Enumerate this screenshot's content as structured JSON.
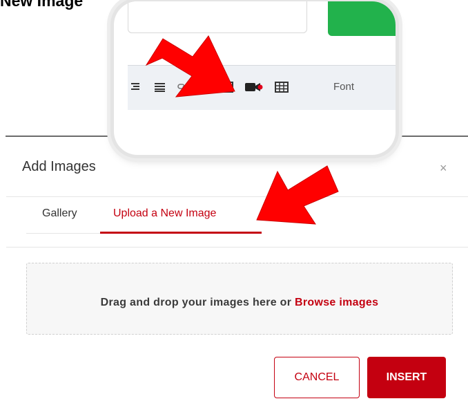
{
  "heading": "New Image",
  "toolbar": {
    "font_label": "Font",
    "icons": [
      "align-right-icon",
      "align-justify-icon",
      "link-icon",
      "clear-format-icon",
      "image-icon",
      "video-icon",
      "table-icon"
    ]
  },
  "dialog": {
    "title": "Add Images",
    "close_label": "×",
    "tabs": [
      {
        "label": "Gallery",
        "active": false
      },
      {
        "label": "Upload a New Image",
        "active": true
      }
    ],
    "dropzone": {
      "text": "Drag and drop your images here or ",
      "browse_label": "Browse images"
    },
    "buttons": {
      "cancel": "CANCEL",
      "insert": "INSERT"
    }
  },
  "colors": {
    "accent": "#c40010",
    "add_button": "#22b24c",
    "arrow": "#ff0000"
  }
}
